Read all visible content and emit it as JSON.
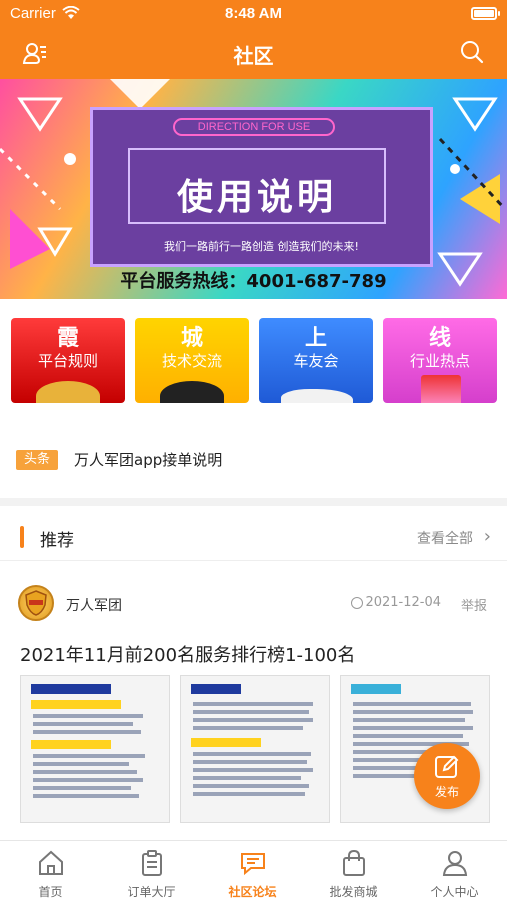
{
  "status_bar": {
    "carrier": "Carrier",
    "time": "8:48 AM"
  },
  "nav": {
    "title": "社区",
    "left_icon": "user-list-icon",
    "right_icon": "search-icon"
  },
  "banner": {
    "tag": "DIRECTION FOR USE",
    "title": "使用说明",
    "subtitle": "我们一路前行一路创造  创造我们的未来!",
    "hotline": "平台服务热线：4001-687-789"
  },
  "categories": [
    {
      "glyph": "霞",
      "label": "平台规则"
    },
    {
      "glyph": "城",
      "label": "技术交流"
    },
    {
      "glyph": "上",
      "label": "车友会"
    },
    {
      "glyph": "线",
      "label": "行业热点"
    }
  ],
  "headline": {
    "tag": "头条",
    "text": "万人军团app接单说明"
  },
  "recommend": {
    "title": "推荐",
    "more": "查看全部"
  },
  "post": {
    "author": "万人军团",
    "date": "2021-12-04",
    "report": "举报",
    "title": "2021年11月前200名服务排行榜1-100名"
  },
  "fab": {
    "label": "发布",
    "icon": "edit-icon"
  },
  "tabs": [
    {
      "label": "首页",
      "icon": "home-icon"
    },
    {
      "label": "订单大厅",
      "icon": "clipboard-icon"
    },
    {
      "label": "社区论坛",
      "icon": "chat-icon",
      "active": true
    },
    {
      "label": "批发商城",
      "icon": "bag-icon"
    },
    {
      "label": "个人中心",
      "icon": "person-icon"
    }
  ],
  "colors": {
    "accent": "#f7821b",
    "tag": "#f7a23b"
  }
}
